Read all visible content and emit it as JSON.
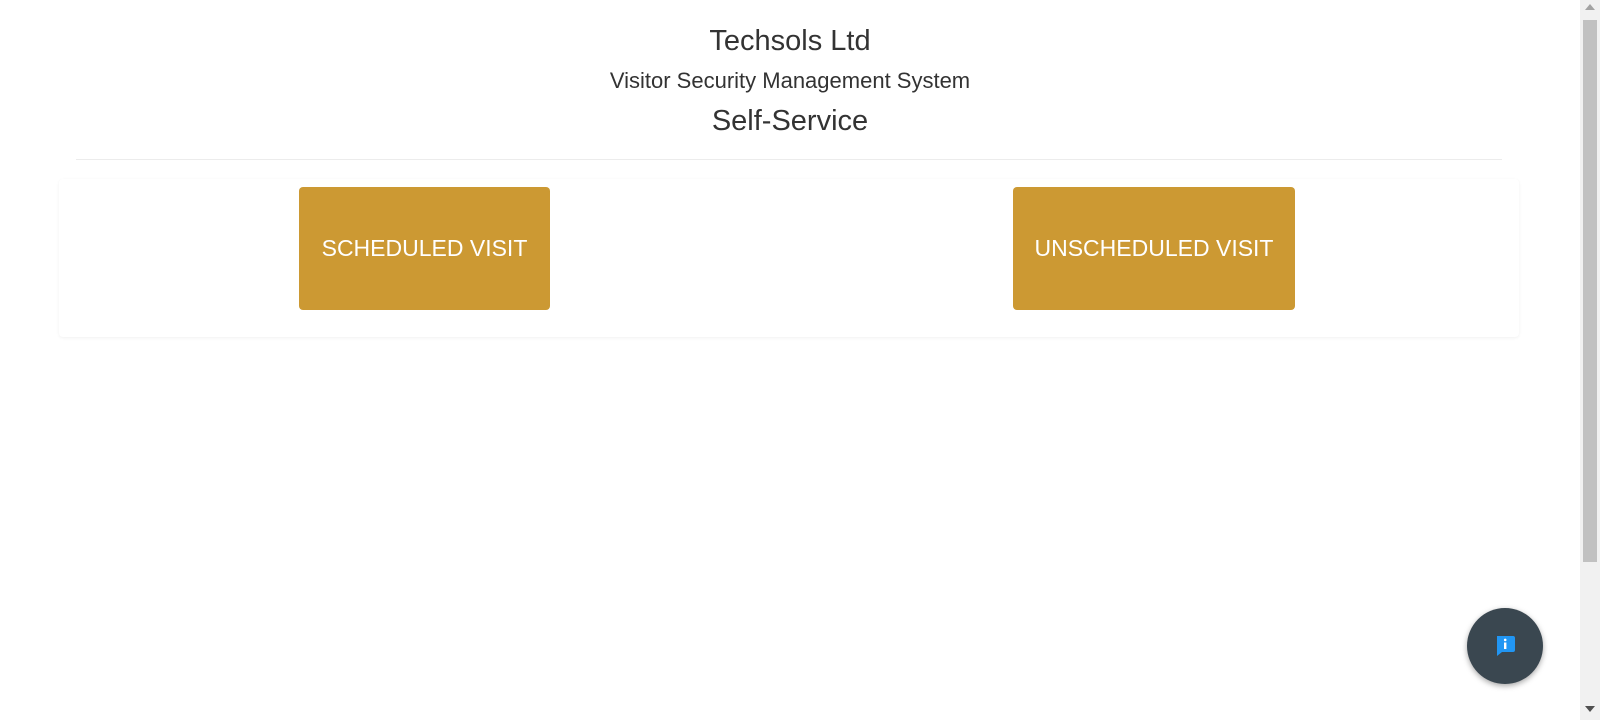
{
  "header": {
    "company_name": "Techsols Ltd",
    "system_name": "Visitor Security Management System",
    "page_title": "Self-Service"
  },
  "actions": {
    "scheduled_label": "SCHEDULED VISIT",
    "unscheduled_label": "UNSCHEDULED VISIT"
  },
  "info_button": {
    "icon": "info-chat-icon"
  },
  "colors": {
    "button_bg": "#cc9933",
    "button_text": "#ffffff",
    "fab_bg": "#3a4750",
    "fab_icon": "#2196f3",
    "text": "#333333"
  }
}
